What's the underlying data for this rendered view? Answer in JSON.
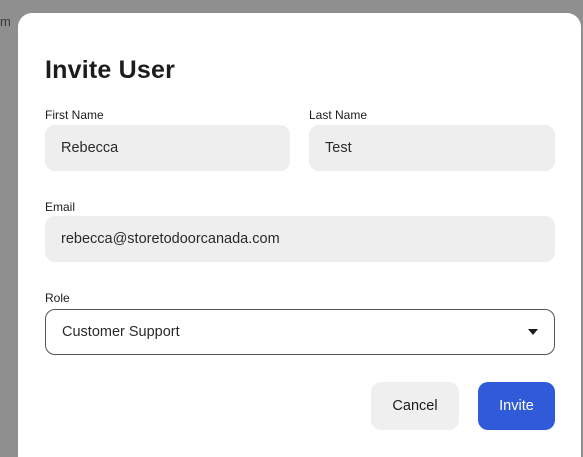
{
  "backdrop": {
    "fragment": "m"
  },
  "modal": {
    "title": "Invite User",
    "first_name": {
      "label": "First Name",
      "value": "Rebecca"
    },
    "last_name": {
      "label": "Last Name",
      "value": "Test"
    },
    "email": {
      "label": "Email",
      "value": "rebecca@storetodoorcanada.com"
    },
    "role": {
      "label": "Role",
      "selected": "Customer Support"
    },
    "cancel_label": "Cancel",
    "invite_label": "Invite"
  },
  "colors": {
    "accent": "#2f5bd8",
    "field_bg": "#eeeeee",
    "overlay": "#8f8f8f"
  },
  "icons": {
    "role_dropdown": "chevron-down-icon"
  }
}
